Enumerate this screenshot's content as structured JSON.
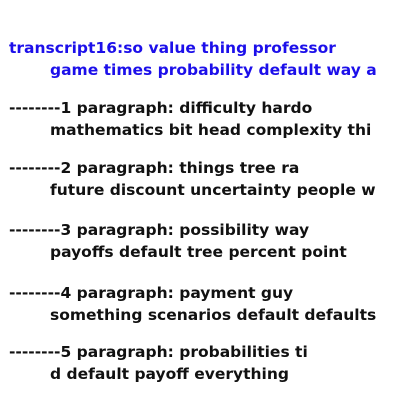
{
  "header": {
    "line1": "transcript16:so value thing professor",
    "line2": "game times probability default way a"
  },
  "paragraphs": [
    {
      "line1": "--------1 paragraph: difficulty hardo",
      "line2": "mathematics bit head complexity thi"
    },
    {
      "line1": "--------2 paragraph: things tree ra",
      "line2": "future discount uncertainty people w"
    },
    {
      "line1": "--------3 paragraph: possibility way",
      "line2": "payoffs default tree percent point"
    },
    {
      "line1": "--------4 paragraph: payment guy",
      "line2": "something scenarios default defaults"
    },
    {
      "line1": "--------5 paragraph: probabilities ti",
      "line2": "d default payoff everything"
    }
  ],
  "colors": {
    "header_text": "#1c0fea",
    "body_text": "#111111",
    "background": "#ffffff"
  }
}
